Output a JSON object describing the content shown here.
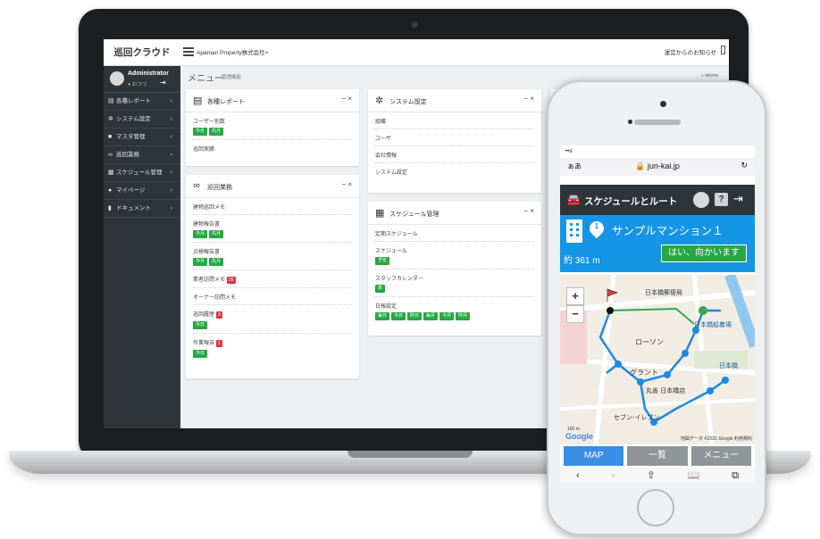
{
  "laptop": {
    "brand": "巡回クラウド",
    "company": "Apaman Property株式会社",
    "company_close": "×",
    "notice": "運営からのお知らせ",
    "user": {
      "name": "Administrator",
      "status": "● わつつ"
    },
    "sidebar_items": [
      {
        "label": "各種レポート",
        "icon": "report-icon"
      },
      {
        "label": "システム設定",
        "icon": "gear-icon"
      },
      {
        "label": "マスタ管理",
        "icon": "book-icon"
      },
      {
        "label": "巡回業務",
        "icon": "binoculars-icon"
      },
      {
        "label": "スケジュール管理",
        "icon": "calendar-icon"
      },
      {
        "label": "マイページ",
        "icon": "user-icon"
      },
      {
        "label": "ドキュメント",
        "icon": "document-icon"
      }
    ],
    "page_title": "メニュー",
    "page_subtitle": "管理機能",
    "home_link": "Home",
    "cards": {
      "reports": {
        "title": "各種レポート",
        "tools": "− ×",
        "rows": [
          {
            "label": "ユーザー別数",
            "tags": [
              "今月",
              "先月"
            ]
          },
          {
            "label": "巡回実績",
            "tags": []
          }
        ]
      },
      "patrol": {
        "title": "巡回業務",
        "tools": "− ×",
        "rows": [
          {
            "label": "建物巡回メモ",
            "tags": [],
            "badge": ""
          },
          {
            "label": "建物報告書",
            "tags": [
              "今月",
              "先月"
            ],
            "badge": ""
          },
          {
            "label": "点検報告書",
            "tags": [
              "今月",
              "先月"
            ],
            "badge": ""
          },
          {
            "label": "業者訪問メモ",
            "tags": [],
            "badge": "26"
          },
          {
            "label": "オーナー訪問メモ",
            "tags": [],
            "badge": ""
          },
          {
            "label": "巡回履歴",
            "tags": [
              "今日"
            ],
            "badge": "3"
          },
          {
            "label": "作業報告",
            "tags": [
              "今日"
            ],
            "badge": "1"
          }
        ]
      },
      "system": {
        "title": "システム設定",
        "tools": "− ×",
        "rows": [
          {
            "label": "組織"
          },
          {
            "label": "ユーザ"
          },
          {
            "label": "会社情報"
          },
          {
            "label": "システム設定"
          }
        ]
      },
      "schedule": {
        "title": "スケジュール管理",
        "tools": "− ×",
        "rows": [
          {
            "label": "定期スケジュール",
            "tags": []
          },
          {
            "label": "スケジュール",
            "tags": [
              "予定"
            ]
          },
          {
            "label": "スタッフカレンダー",
            "tags": [
              "表"
            ]
          },
          {
            "label": "日報設定",
            "tags": [
              "毎日",
              "今日",
              "昨日",
              "毎月",
              "今月",
              "昨月"
            ]
          }
        ]
      }
    }
  },
  "phone": {
    "status": "••ıl",
    "aa": "ぁあ",
    "url": "jun-kai.jp",
    "reload": "↻",
    "app_title": "スケジュールとルート",
    "help": "?",
    "destination_number": "1",
    "destination_name": "サンプルマンション１",
    "distance": "約 361 m",
    "go_button": "はい、向かいます",
    "zoom_in": "+",
    "zoom_out": "−",
    "map_logo": "Google",
    "map_scale": "100 m",
    "map_credit": "地図データ ©2021 Google  利用規約",
    "map_labels": [
      "日本橋郵便局",
      "日本橋船着場",
      "日本橋",
      "ローソン",
      "グラント",
      "丸善 日本橋店",
      "セブン-イレブン"
    ],
    "tabs": [
      "MAP",
      "一覧",
      "メニュー"
    ],
    "safari": [
      "‹",
      "›",
      "⇧",
      "📖",
      "⧉"
    ]
  },
  "colors": {
    "sidebar": "#2f3439",
    "accent_green": "#28a745",
    "accent_red": "#dc3545",
    "route_blue": "#1e88e5",
    "dest_bar": "#1495e6"
  }
}
